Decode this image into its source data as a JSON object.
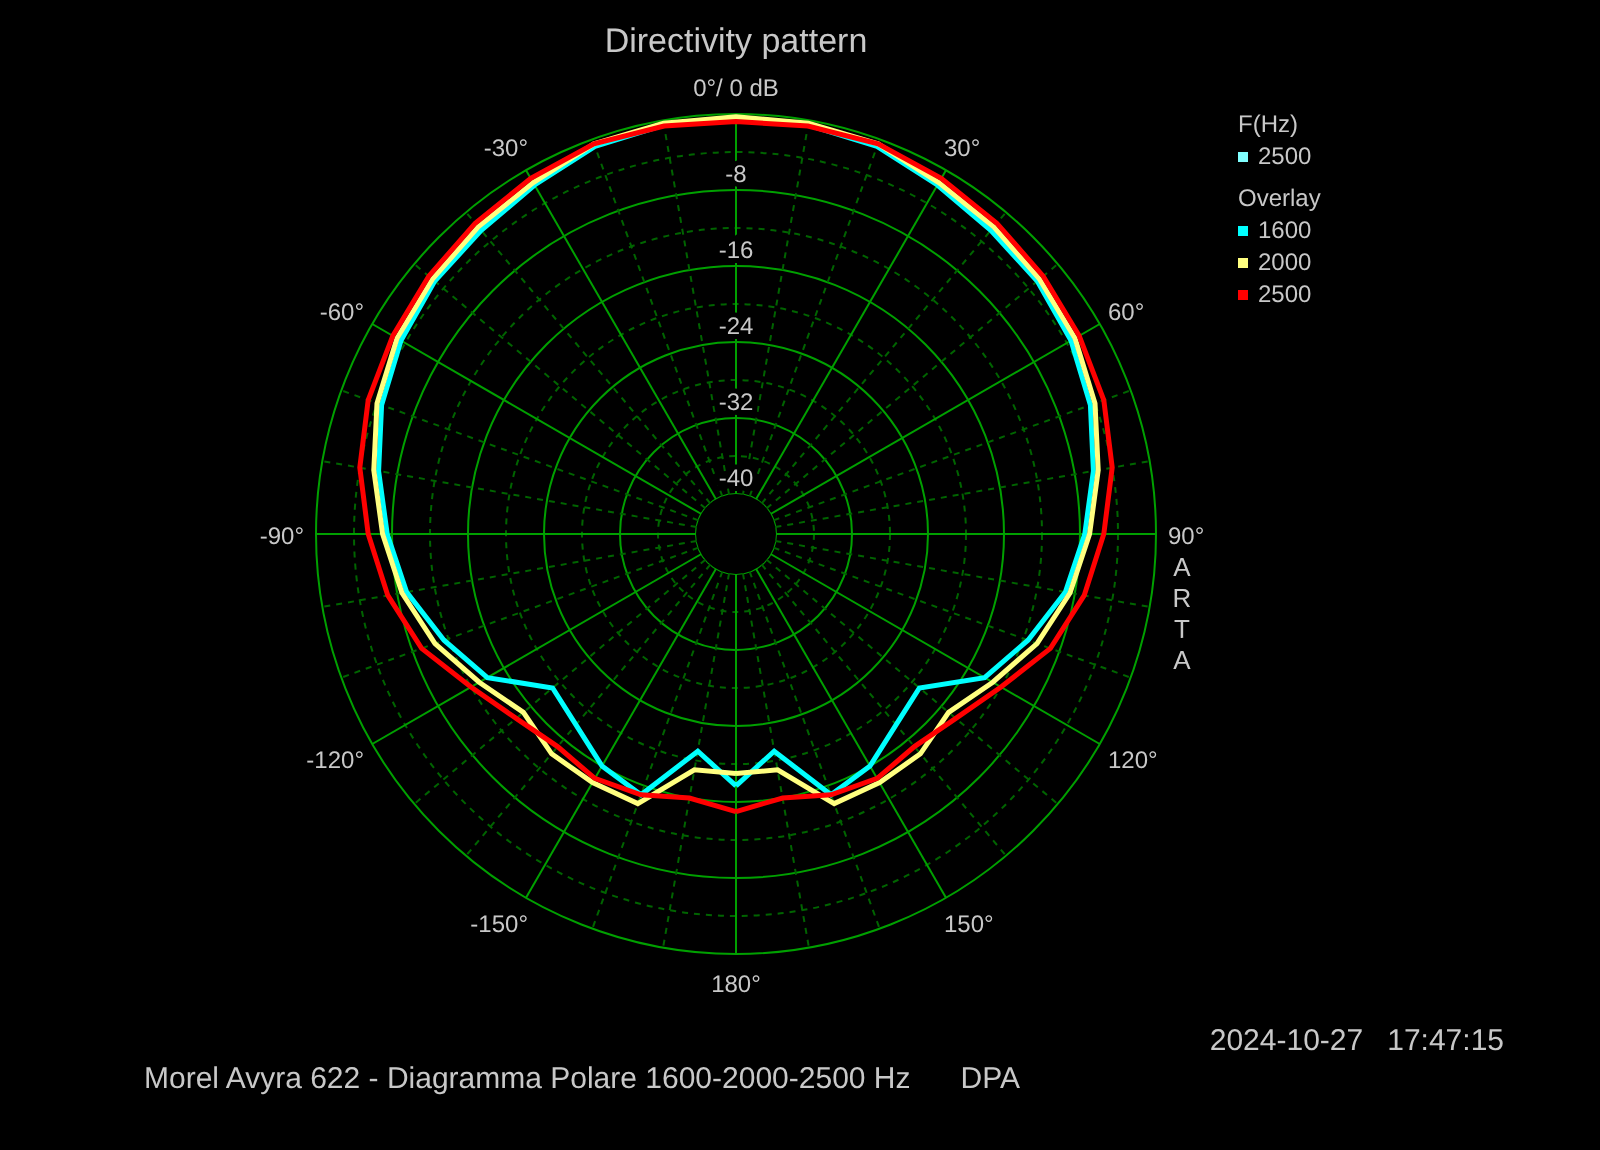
{
  "chart": {
    "title": "Directivity pattern",
    "angle_labels": [
      "0°/ 0 dB",
      "30°",
      "60°",
      "90°",
      "120°",
      "150°",
      "180°",
      "-150°",
      "-120°",
      "-90°",
      "-60°",
      "-30°"
    ],
    "ring_labels": [
      "-8",
      "-16",
      "-24",
      "-32",
      "-40"
    ],
    "side_label": "ARTA"
  },
  "legend": {
    "heading": "F(Hz)",
    "current": [
      {
        "label": "2500",
        "color": "#80ffff"
      }
    ],
    "overlay_heading": "Overlay",
    "overlay": [
      {
        "label": "1600",
        "color": "#00ffff"
      },
      {
        "label": "2000",
        "color": "#ffff80"
      },
      {
        "label": "2500",
        "color": "#ff0000"
      }
    ]
  },
  "footer": {
    "date": "2024-10-27",
    "time": "17:47:15",
    "caption": "Morel Avyra 622 - Diagramma Polare 1600-2000-2500 Hz",
    "tag": "DPA"
  }
}
